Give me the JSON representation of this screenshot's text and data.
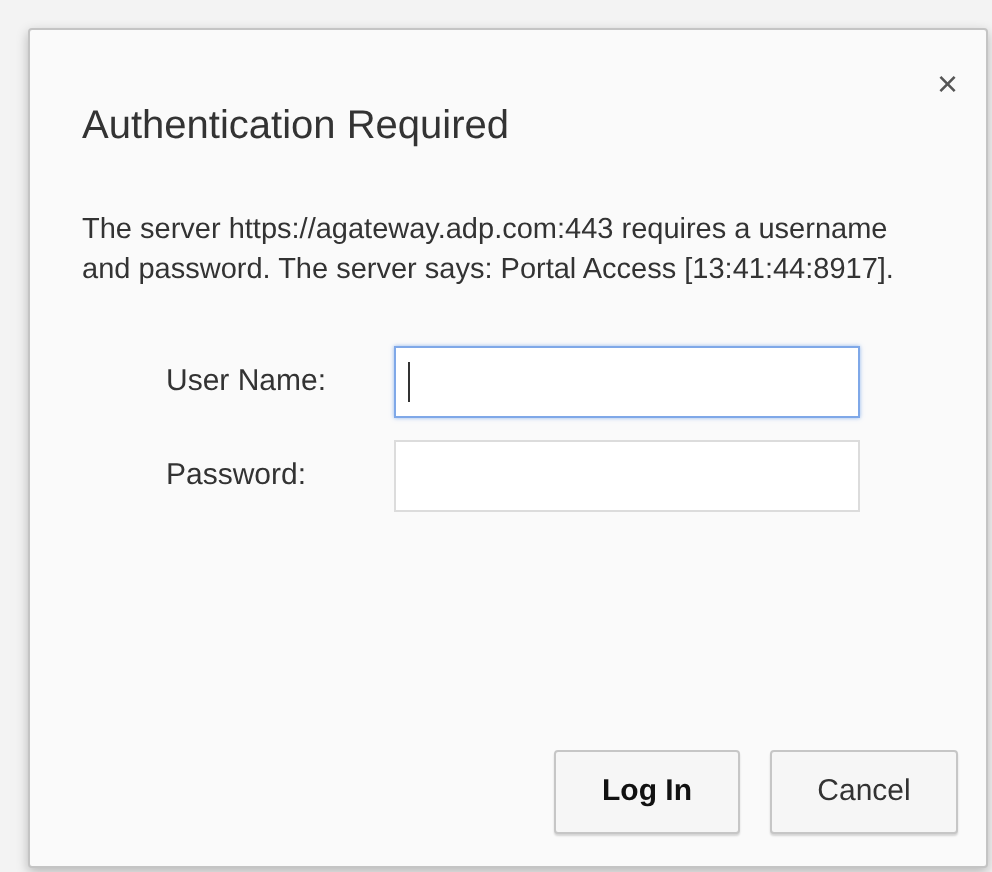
{
  "dialog": {
    "title": "Authentication Required",
    "close": "×",
    "message": "The server https://agateway.adp.com:443 requires a username and password. The server says: Portal Access [13:41:44:8917].",
    "fields": [
      {
        "label": "User Name:",
        "focused": true
      },
      {
        "label": "Password:",
        "focused": false
      }
    ],
    "buttons": [
      {
        "label": "Log In",
        "default": true
      },
      {
        "label": "Cancel",
        "default": false
      }
    ]
  }
}
